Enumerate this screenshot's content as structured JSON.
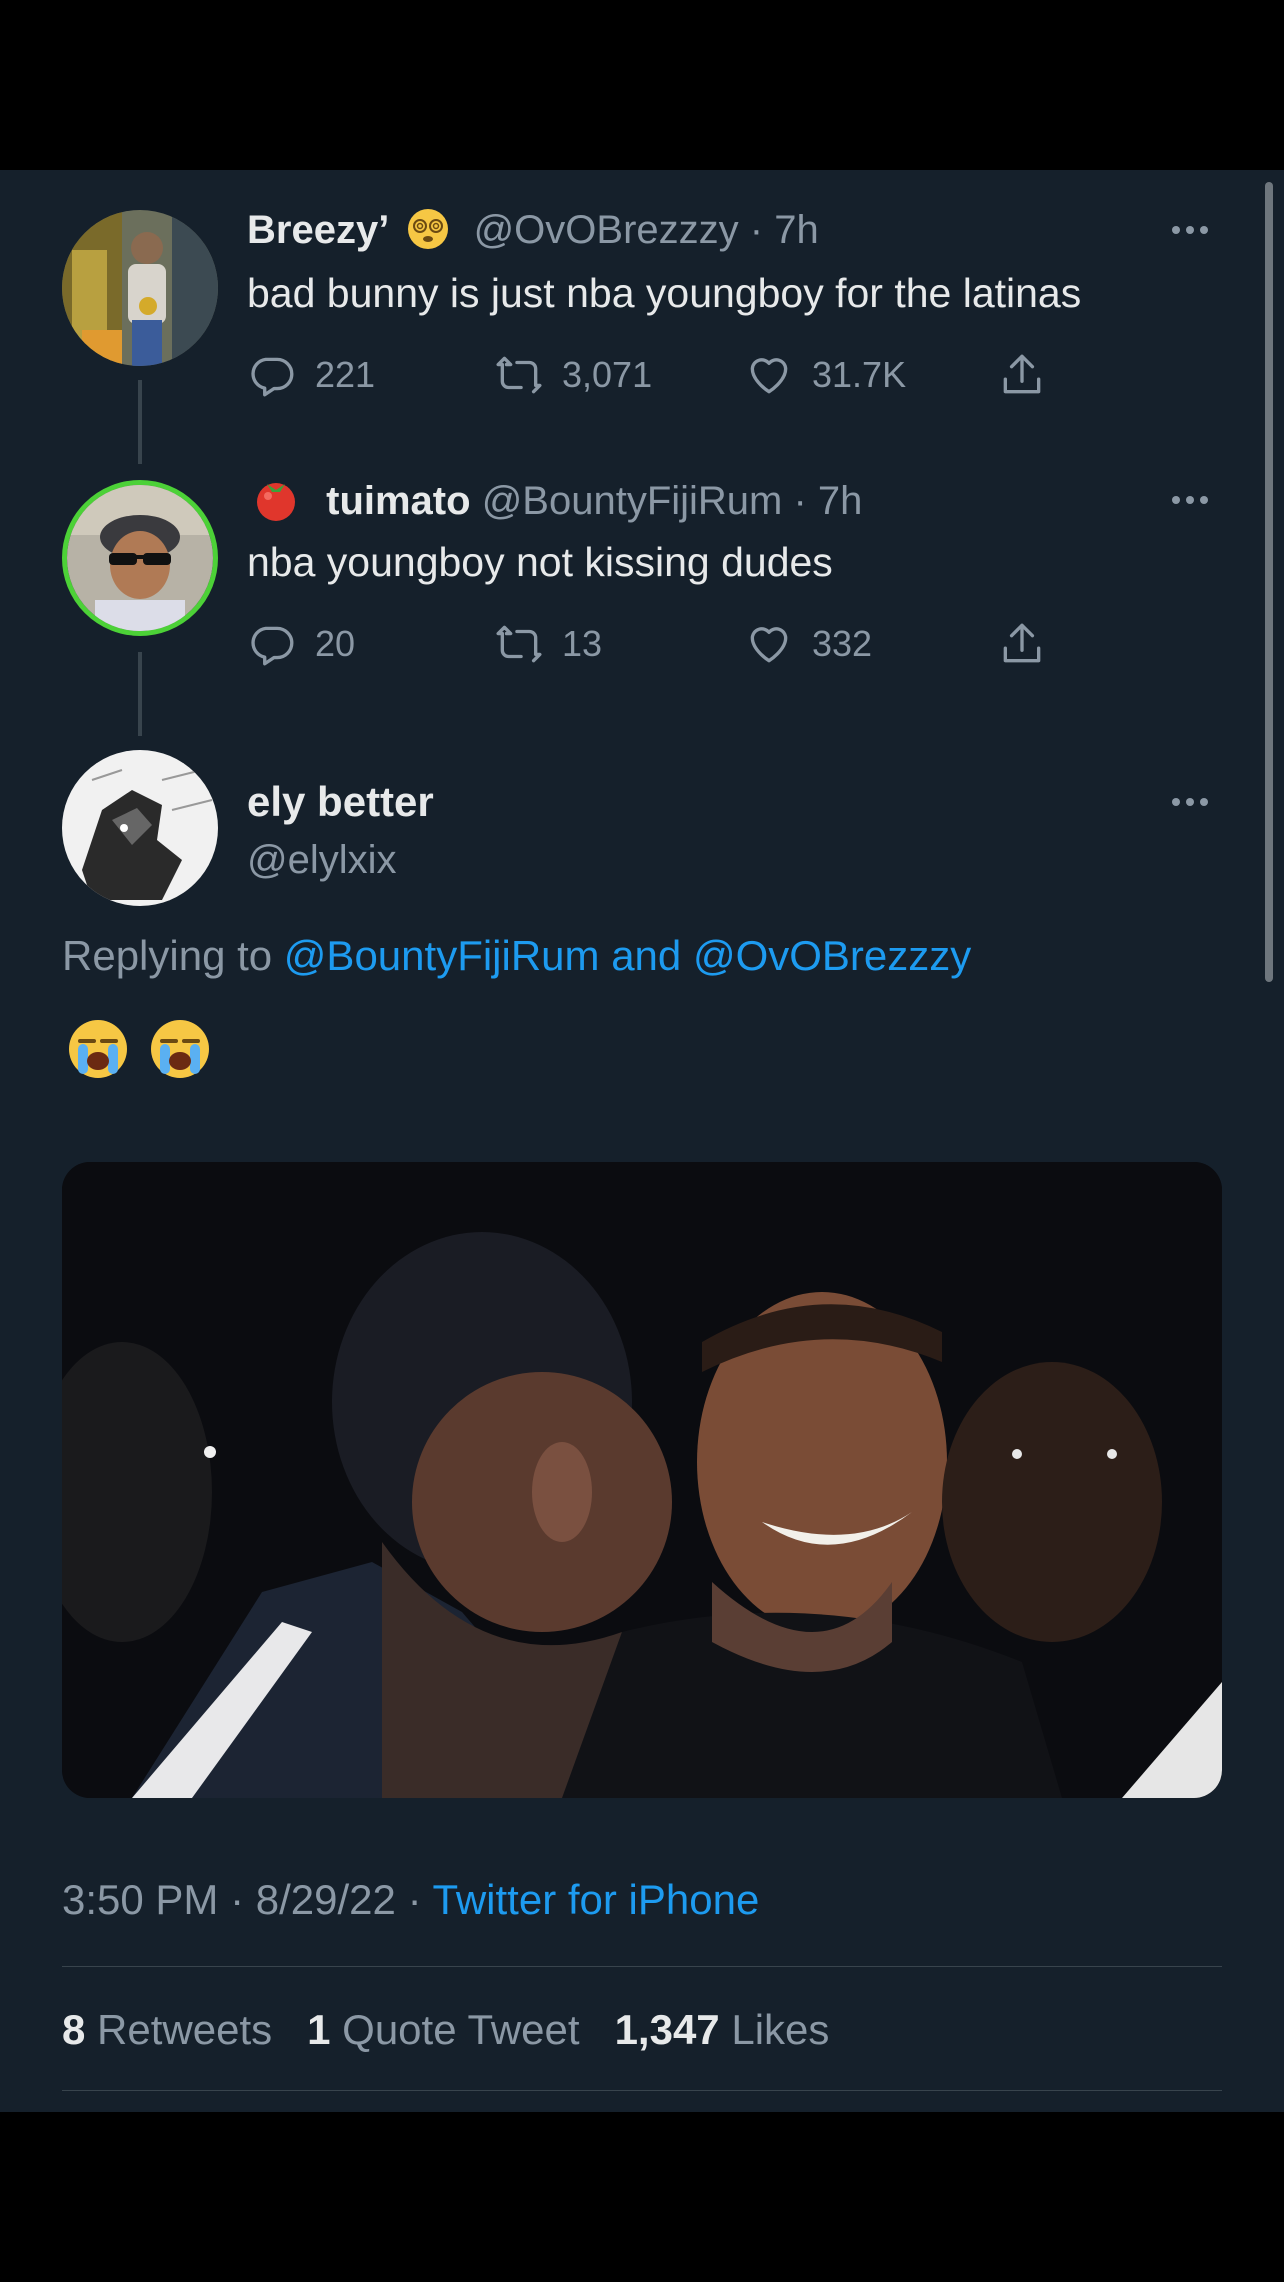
{
  "tweets": [
    {
      "display_name": "Breezy’",
      "badge_emoji": "dizzy-face-emoji",
      "handle": "@OvOBrezzzy",
      "time": "· 7h",
      "text": "bad bunny is just nba youngboy for the latinas",
      "replies": "221",
      "retweets": "3,071",
      "likes": "31.7K"
    },
    {
      "display_name": "tuimato",
      "prefix_emoji": "tomato-emoji",
      "handle": "@BountyFijiRum",
      "time": "· 7h",
      "text": "nba youngboy not kissing dudes",
      "replies": "20",
      "retweets": "13",
      "likes": "332"
    }
  ],
  "main_tweet": {
    "display_name": "ely better",
    "handle": "@elylxix",
    "replying_label": "Replying to",
    "replying_user1": "@BountyFijiRum",
    "replying_and": "and",
    "replying_user2": "@OvOBrezzzy",
    "emojis": [
      "loudly-crying-face-emoji",
      "loudly-crying-face-emoji"
    ],
    "time": "3:50 PM",
    "date": "8/29/22",
    "source": "Twitter for iPhone",
    "retweet_count": "8",
    "retweet_label": "Retweets",
    "quote_count": "1",
    "quote_label": "Quote Tweet",
    "like_count": "1,347",
    "like_label": "Likes"
  },
  "colors": {
    "background": "#15202b",
    "text": "#e7e9ea",
    "muted": "#8b98a5",
    "link": "#1d9bf0",
    "story_ring": "#4cd137"
  }
}
